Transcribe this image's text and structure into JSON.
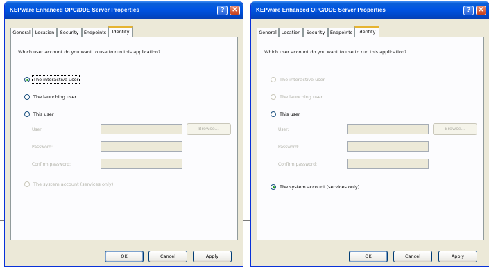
{
  "dialogs": [
    {
      "title": "KEPware Enhanced OPC/DDE Server Properties",
      "help_glyph": "?",
      "close_glyph": "✕",
      "tabs": [
        "General",
        "Location",
        "Security",
        "Endpoints",
        "Identity"
      ],
      "active_tab": "Identity",
      "question": "Which user account do you want to use to run this application?",
      "options": [
        {
          "label": "The interactive user",
          "checked": true,
          "enabled": true
        },
        {
          "label": "The launching user",
          "checked": false,
          "enabled": true
        },
        {
          "label": "This user",
          "checked": false,
          "enabled": true
        },
        {
          "label": "The system account (services only)",
          "checked": false,
          "enabled": false
        }
      ],
      "fields": [
        {
          "label": "User:",
          "value": ""
        },
        {
          "label": "Password:",
          "value": ""
        },
        {
          "label": "Confirm password:",
          "value": ""
        }
      ],
      "browse_label": "Browse...",
      "buttons": {
        "ok": "OK",
        "cancel": "Cancel",
        "apply": "Apply"
      }
    },
    {
      "title": "KEPware Enhanced OPC/DDE Server Properties",
      "help_glyph": "?",
      "close_glyph": "✕",
      "tabs": [
        "General",
        "Location",
        "Security",
        "Endpoints",
        "Identity"
      ],
      "active_tab": "Identity",
      "question": "Which user account do you want to use to run this application?",
      "options": [
        {
          "label": "The interactive user",
          "checked": false,
          "enabled": false
        },
        {
          "label": "The launching user",
          "checked": false,
          "enabled": false
        },
        {
          "label": "This user",
          "checked": false,
          "enabled": true
        },
        {
          "label": "The system account (services only).",
          "checked": true,
          "enabled": true
        }
      ],
      "fields": [
        {
          "label": "User:",
          "value": ""
        },
        {
          "label": "Password:",
          "value": ""
        },
        {
          "label": "Confirm password:",
          "value": ""
        }
      ],
      "browse_label": "Browse...",
      "buttons": {
        "ok": "OK",
        "cancel": "Cancel",
        "apply": "Apply"
      }
    }
  ]
}
